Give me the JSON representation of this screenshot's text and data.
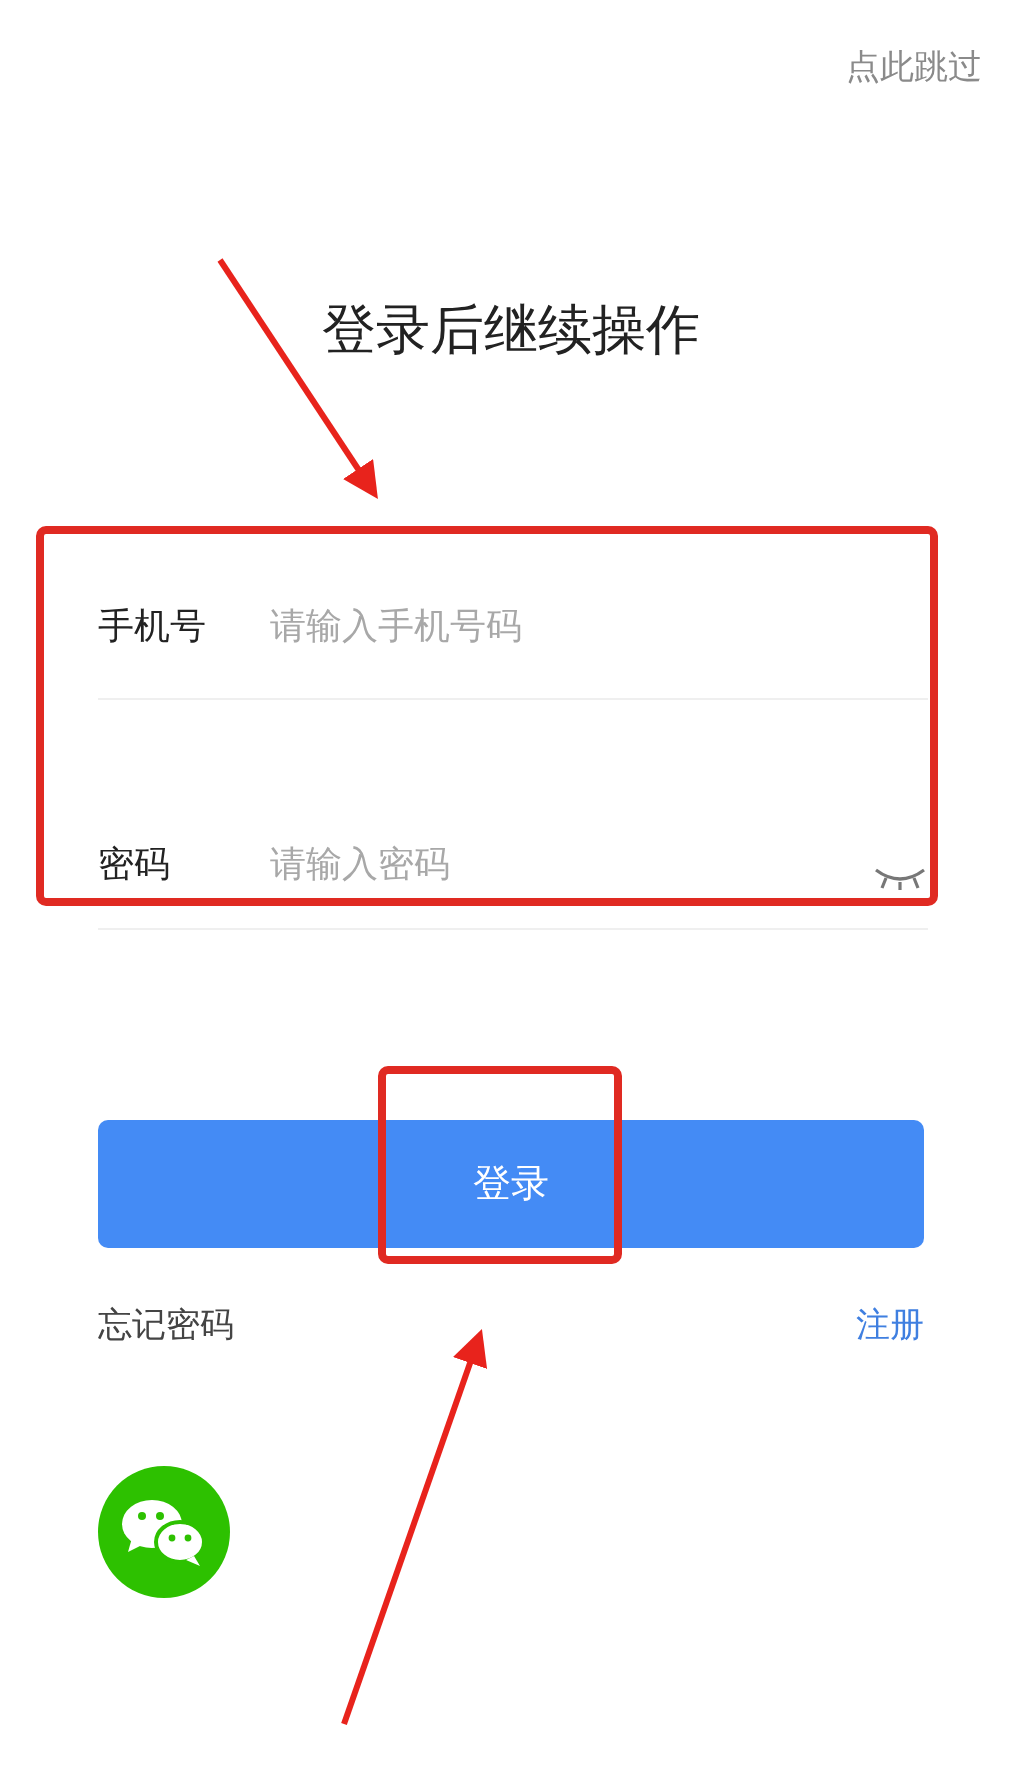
{
  "skip_link": "点此跳过",
  "title": "登录后继续操作",
  "fields": [
    {
      "kind": "text",
      "label": "手机号",
      "placeholder": "请输入手机号码"
    },
    {
      "kind": "password",
      "label": "密码",
      "placeholder": "请输入密码"
    }
  ],
  "login_button": "登录",
  "forgot_link": "忘记密码",
  "register_link": "注册"
}
